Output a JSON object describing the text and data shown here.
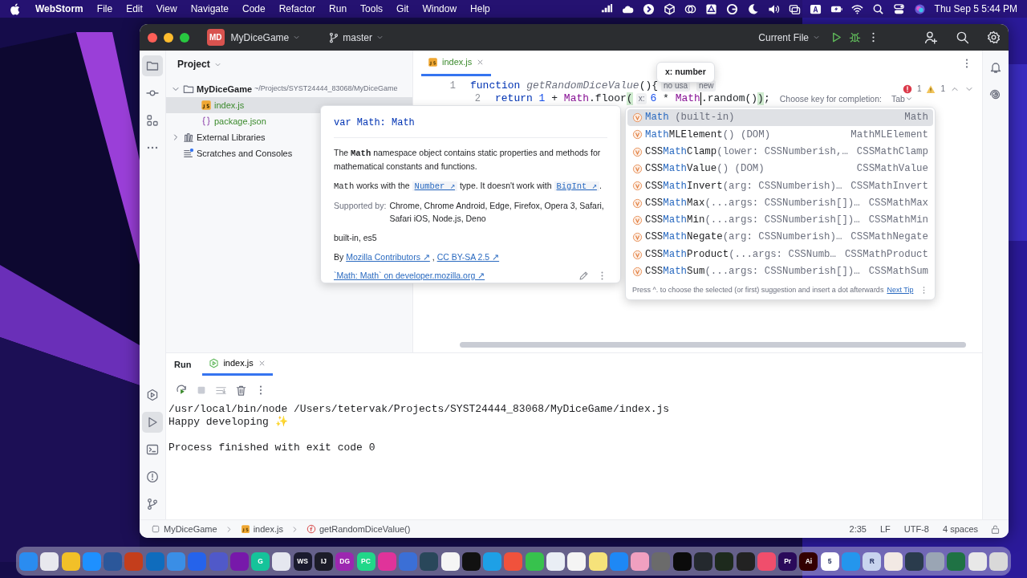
{
  "menubar": {
    "app": "WebStorm",
    "menus": [
      "File",
      "Edit",
      "View",
      "Navigate",
      "Code",
      "Refactor",
      "Run",
      "Tools",
      "Git",
      "Window",
      "Help"
    ],
    "status_icons": [
      {
        "kind": "bars"
      },
      {
        "kind": "cloud"
      },
      {
        "kind": "arrow"
      },
      {
        "kind": "cube"
      },
      {
        "kind": "link"
      },
      {
        "kind": "drive"
      },
      {
        "kind": "grammar"
      },
      {
        "kind": "moon"
      },
      {
        "kind": "volume"
      },
      {
        "kind": "screens"
      },
      {
        "kind": "keyboard"
      },
      {
        "kind": "battery"
      },
      {
        "kind": "wifi"
      },
      {
        "kind": "search"
      },
      {
        "kind": "control"
      },
      {
        "kind": "siri"
      }
    ],
    "clock": "Thu Sep 5  5:44 PM"
  },
  "window": {
    "project_badge": "MD",
    "project": "MyDiceGame",
    "branch": "master",
    "run_config": "Current File"
  },
  "left_tools": {
    "top": [
      {
        "kind": "folder",
        "selected": true
      },
      {
        "kind": "commit",
        "selected": false
      },
      {
        "kind": "structure",
        "selected": false
      },
      {
        "kind": "more",
        "selected": false
      }
    ],
    "bottom": [
      {
        "kind": "services",
        "selected": false
      },
      {
        "kind": "run",
        "selected": true
      },
      {
        "kind": "terminal",
        "selected": false
      },
      {
        "kind": "problems",
        "selected": false
      },
      {
        "kind": "git",
        "selected": false
      }
    ]
  },
  "right_tools": [
    {
      "kind": "bell",
      "selected": false
    },
    {
      "kind": "ai",
      "selected": false
    }
  ],
  "project_panel": {
    "title": "Project",
    "tree": [
      {
        "label": "MyDiceGame",
        "detail": "~/Projects/SYST24444_83068/MyDiceGame",
        "kind": "folder",
        "expanded": true,
        "selected": false,
        "children": [
          {
            "label": "index.js",
            "kind": "js",
            "selected": true
          },
          {
            "label": "package.json",
            "kind": "json",
            "selected": false
          }
        ]
      },
      {
        "label": "External Libraries",
        "kind": "library",
        "expanded": false,
        "selected": false
      },
      {
        "label": "Scratches and Consoles",
        "kind": "scratches",
        "selected": false
      }
    ]
  },
  "editor": {
    "tabs": [
      {
        "label": "index.js",
        "selected": true
      }
    ],
    "tooltip": "x: number",
    "errors": "1",
    "warnings": "1",
    "lines": [
      {
        "number": "1",
        "kind": "declaration",
        "tokens": [
          {
            "kind": "keyword",
            "text": "function "
          },
          {
            "kind": "unused",
            "text": "getRandomDiceValue"
          },
          {
            "kind": "plain",
            "text": "(){"
          },
          {
            "kind": "inlay",
            "text": "no usa"
          },
          {
            "kind": "inlay",
            "text": "new"
          }
        ]
      },
      {
        "number": "2",
        "kind": "statement",
        "tokens": [
          {
            "kind": "keyword",
            "text": "return "
          },
          {
            "kind": "number",
            "text": "1"
          },
          {
            "kind": "plain",
            "text": " + "
          },
          {
            "kind": "global",
            "text": "Math"
          },
          {
            "kind": "plain",
            "text": ".floor"
          },
          {
            "kind": "brace",
            "text": "("
          },
          {
            "kind": "inlay",
            "text": "x:"
          },
          {
            "kind": "number",
            "text": "6"
          },
          {
            "kind": "plain",
            "text": " * "
          },
          {
            "kind": "global",
            "text": "Math",
            "cursor": true
          },
          {
            "kind": "plain",
            "text": ".random()"
          },
          {
            "kind": "brace",
            "text": ")"
          },
          {
            "kind": "plain",
            "text": ";"
          }
        ]
      }
    ],
    "completion_hint": {
      "label": "Choose key for completion:",
      "key": "Tab"
    }
  },
  "doc_popup": {
    "signature": "var Math: Math",
    "description": "The **Math** namespace object contains static properties and methods for mathematical constants and functions.",
    "compat": [
      {
        "kind": "code",
        "text": "Math"
      },
      {
        "kind": "text",
        "text": " works with the "
      },
      {
        "kind": "link",
        "text": "Number ↗"
      },
      {
        "kind": "text",
        "text": " type. It doesn't work with "
      },
      {
        "kind": "link",
        "text": "BigInt ↗"
      },
      {
        "kind": "text",
        "text": "."
      }
    ],
    "supported_label": "Supported by:",
    "supported": "Chrome, Chrome Android, Edge, Firefox, Opera 3, Safari, Safari iOS, Node.js, Deno",
    "tags": "built-in, es5",
    "credits": [
      {
        "kind": "text",
        "text": "By "
      },
      {
        "kind": "link",
        "text": "Mozilla Contributors ↗"
      },
      {
        "kind": "text",
        "text": " , "
      },
      {
        "kind": "link",
        "text": "CC BY-SA 2.5 ↗"
      }
    ],
    "source_link": "`Math: Math` on developer.mozilla.org ↗"
  },
  "completion": {
    "items": [
      {
        "match": "Math",
        "params": " (built-in)",
        "type": "Math",
        "selected": true
      },
      {
        "match": "Math",
        "name_rest": "MLElement",
        "params": "() (DOM)",
        "type": "MathMLElement",
        "selected": false
      },
      {
        "prefix": "CSS",
        "match": "Math",
        "name_rest": "Clamp",
        "params": "(lower: CSSNumberish,…",
        "type": "CSSMathClamp",
        "selected": false
      },
      {
        "prefix": "CSS",
        "match": "Math",
        "name_rest": "Value",
        "params": "() (DOM)",
        "type": "CSSMathValue",
        "selected": false
      },
      {
        "prefix": "CSS",
        "match": "Math",
        "name_rest": "Invert",
        "params": "(arg: CSSNumberish)…",
        "type": "CSSMathInvert",
        "selected": false
      },
      {
        "prefix": "CSS",
        "match": "Math",
        "name_rest": "Max",
        "params": "(...args: CSSNumberish[])…",
        "type": "CSSMathMax",
        "selected": false
      },
      {
        "prefix": "CSS",
        "match": "Math",
        "name_rest": "Min",
        "params": "(...args: CSSNumberish[])…",
        "type": "CSSMathMin",
        "selected": false
      },
      {
        "prefix": "CSS",
        "match": "Math",
        "name_rest": "Negate",
        "params": "(arg: CSSNumberish)…",
        "type": "CSSMathNegate",
        "selected": false
      },
      {
        "prefix": "CSS",
        "match": "Math",
        "name_rest": "Product",
        "params": "(...args: CSSNumb…",
        "type": "CSSMathProduct",
        "selected": false
      },
      {
        "prefix": "CSS",
        "match": "Math",
        "name_rest": "Sum",
        "params": "(...args: CSSNumberish[])…",
        "type": "CSSMathSum",
        "selected": false
      }
    ],
    "footer": "Press ^. to choose the selected (or first) suggestion and insert a dot afterwards",
    "footer_link": "Next Tip"
  },
  "run_panel": {
    "title": "Run",
    "tabs": [
      {
        "label": "index.js",
        "selected": true
      }
    ],
    "output": [
      {
        "kind": "command",
        "text": "/usr/local/bin/node /Users/tetervak/Projects/SYST24444_83068/MyDiceGame/index.js"
      },
      {
        "kind": "stdout",
        "text": "Happy developing ✨"
      },
      {
        "kind": "status",
        "text": "Process finished with exit code 0"
      }
    ]
  },
  "status_bar": {
    "breadcrumbs": [
      {
        "kind": "module",
        "label": "MyDiceGame"
      },
      {
        "kind": "js",
        "label": "index.js"
      },
      {
        "kind": "function",
        "label": "getRandomDiceValue()"
      }
    ],
    "items": [
      "2:35",
      "LF",
      "UTF-8",
      "4 spaces"
    ]
  },
  "dock": [
    {
      "color": "#2a8cf0"
    },
    {
      "color": "#e8e8ee"
    },
    {
      "color": "#f2c028"
    },
    {
      "color": "#1e90ff"
    },
    {
      "color": "#2b579a"
    },
    {
      "color": "#c43e1c"
    },
    {
      "color": "#0f6cbd"
    },
    {
      "color": "#3a8ee6"
    },
    {
      "color": "#2563eb"
    },
    {
      "color": "#5059c9"
    },
    {
      "color": "#7719aa"
    },
    {
      "color": "#15c39a",
      "label": "G"
    },
    {
      "color": "#e5e7ef"
    },
    {
      "color": "#1a1a2e",
      "label": "WS"
    },
    {
      "color": "#1c1c28",
      "label": "IJ"
    },
    {
      "color": "#9c27b0",
      "label": "DG"
    },
    {
      "color": "#21d789",
      "label": "PC"
    },
    {
      "color": "#e0339a"
    },
    {
      "color": "#3b6fd6"
    },
    {
      "color": "#29475a"
    },
    {
      "color": "#f5f5f5"
    },
    {
      "color": "#111111"
    },
    {
      "color": "#1ea0e6"
    },
    {
      "color": "#f0523c"
    },
    {
      "color": "#37c24d"
    },
    {
      "color": "#e9eef5"
    },
    {
      "color": "#f4f4f4"
    },
    {
      "color": "#f6e27a"
    },
    {
      "color": "#1e88f5"
    },
    {
      "color": "#f0a0c0"
    },
    {
      "color": "#6b6b6b"
    },
    {
      "color": "#0b0b0b"
    },
    {
      "color": "#24292e"
    },
    {
      "color": "#1d2a1d"
    },
    {
      "color": "#222222"
    },
    {
      "color": "#f04e6c"
    },
    {
      "color": "#2a0a5a",
      "label": "Pr"
    },
    {
      "color": "#330000",
      "label": "Ai"
    },
    {
      "color": "#ffffff",
      "label": "5"
    },
    {
      "color": "#2496ed"
    },
    {
      "color": "#c8d4ee",
      "label": "R"
    },
    {
      "color": "#f2e9e4"
    },
    {
      "color": "#2a3b4c"
    },
    {
      "color": "#9aa5b4"
    },
    {
      "color": "#1f7244"
    },
    {
      "color": "#e8e8e8"
    },
    {
      "color": "#d9d9d9"
    }
  ]
}
